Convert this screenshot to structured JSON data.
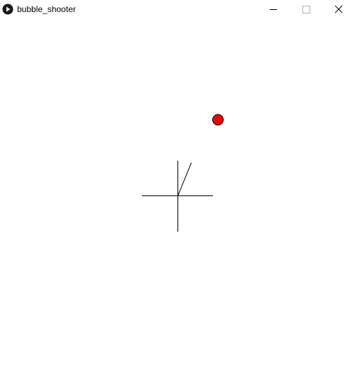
{
  "window": {
    "title": "bubble_shooter",
    "app_icon": "play-icon",
    "controls": {
      "minimize_icon": "minimize-icon",
      "maximize_icon": "maximize-icon",
      "close_icon": "close-icon"
    }
  },
  "scene": {
    "background_color": "#ffffff",
    "bubble": {
      "fill_color": "#ee0000",
      "stroke_color": "#000000"
    },
    "shooter": {
      "stroke_color": "#000000"
    }
  }
}
